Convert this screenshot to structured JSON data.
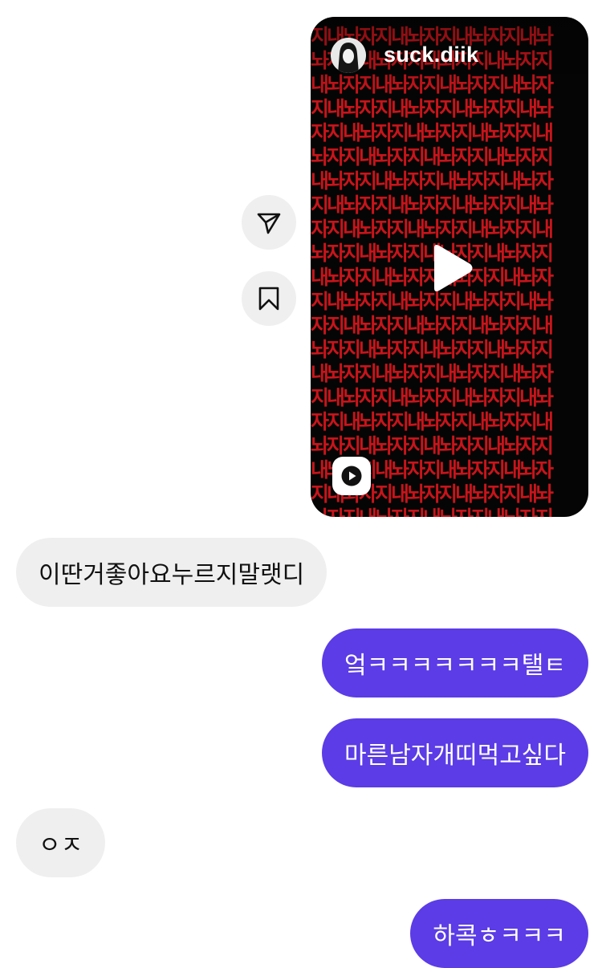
{
  "actions": {
    "share_icon": "paper-plane-icon",
    "save_icon": "bookmark-icon"
  },
  "reel": {
    "username": "suck.diik",
    "pattern_rows": [
      "지내놔자지내놔자지내놔자지내놔",
      "놔자지내놔자지내놔자지내놔자지",
      "내놔자지내놔자지내놔자지내놔자",
      "지내놔자지내놔자지내놔자지내놔",
      "자지내놔자지내놔자지내놔자지내",
      "놔자지내놔자지내놔자지내놔자지",
      "내놔자지내놔자지내놔자지내놔자",
      "지내놔자지내놔자지내놔자지내놔",
      "자지내놔자지내놔자지내놔자지내",
      "놔자지내놔자지내놔자지내놔자지",
      "내놔자지내놔자지내놔자지내놔자",
      "지내놔자지내놔자지내놔자지내놔",
      "자지내놔자지내놔자지내놔자지내",
      "놔자지내놔자지내놔자지내놔자지",
      "내놔자지내놔자지내놔자지내놔자",
      "지내놔자지내놔자지내놔자지내놔",
      "자지내놔자지내놔자지내놔자지내",
      "놔자지내놔자지내놔자지내놔자지",
      "내놔자지내놔자지내놔자지내놔자",
      "지내놔자지내놔자지내놔자지내놔",
      "놔자지내놔자지내놔자지내놔자지"
    ],
    "colors": {
      "text": "#c8141a",
      "background": "#050505"
    }
  },
  "messages": [
    {
      "side": "in",
      "text": "이딴거좋아요누르지말랫디"
    },
    {
      "side": "out",
      "text": "엌ㅋㅋㅋㅋㅋㅋㅋ탤ㅌ"
    },
    {
      "side": "out",
      "text": "마른남자개띠먹고싶다"
    },
    {
      "side": "in",
      "text": "ㅇㅈ"
    },
    {
      "side": "out",
      "text": "하콕ㅎㅋㅋㅋ"
    }
  ],
  "colors": {
    "outgoing_bubble": "#5b3ce6",
    "incoming_bubble": "#efefef"
  }
}
